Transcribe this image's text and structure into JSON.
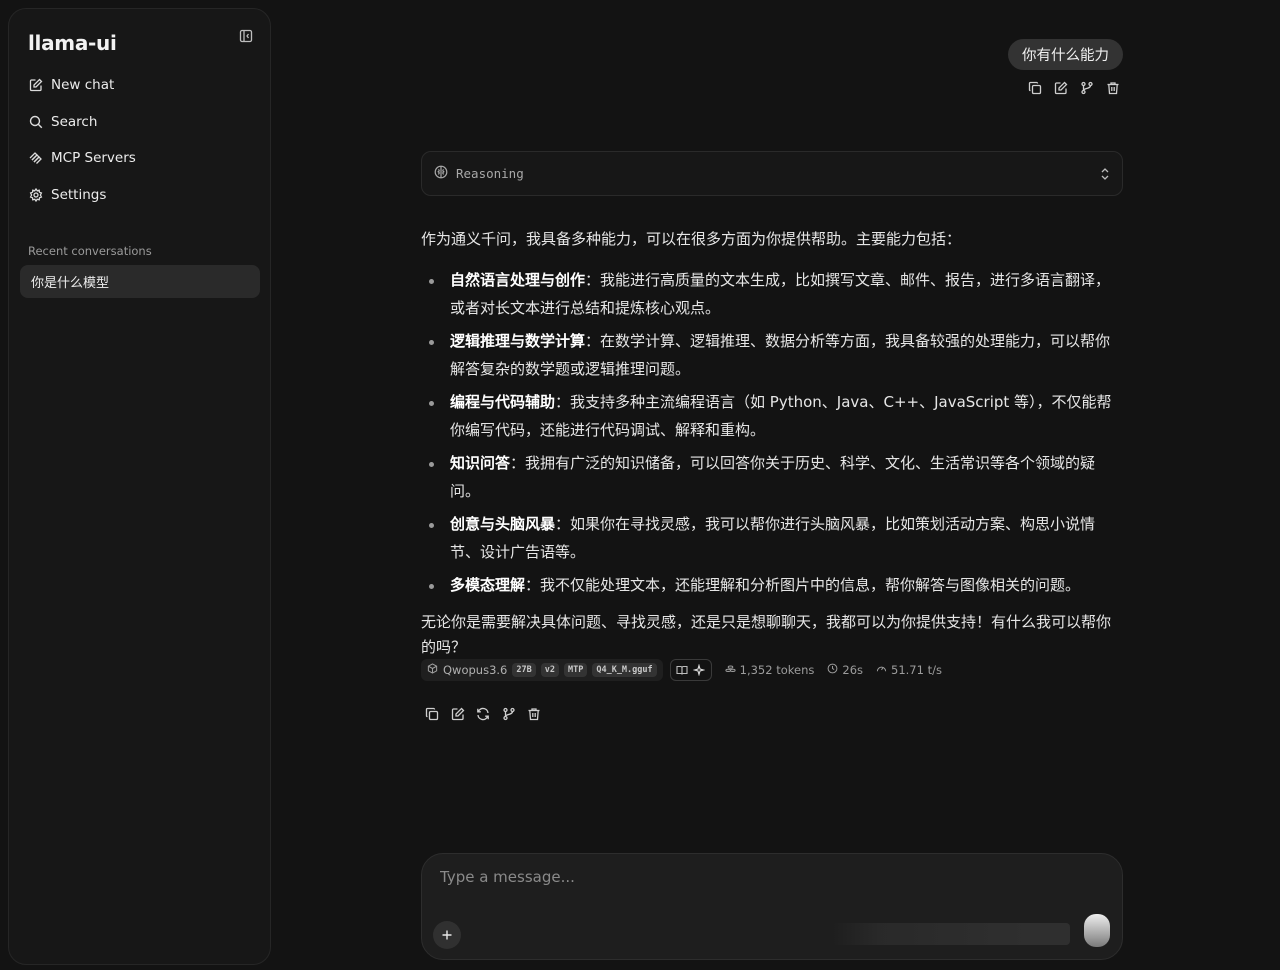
{
  "sidebar": {
    "brand": "llama-ui",
    "nav": [
      {
        "label": "New chat",
        "icon": "edit-icon"
      },
      {
        "label": "Search",
        "icon": "search-icon"
      },
      {
        "label": "MCP Servers",
        "icon": "mcp-icon"
      },
      {
        "label": "Settings",
        "icon": "gear-icon"
      }
    ],
    "recent_label": "Recent conversations",
    "conversations": [
      {
        "title": "你是什么模型",
        "active": true
      }
    ]
  },
  "chat": {
    "user_message": "你有什么能力",
    "reasoning_label": "Reasoning",
    "answer": {
      "intro": "作为通义千问，我具备多种能力，可以在很多方面为你提供帮助。主要能力包括：",
      "items": [
        {
          "title": "自然语言处理与创作",
          "text": "：我能进行高质量的文本生成，比如撰写文章、邮件、报告，进行多语言翻译，或者对长文本进行总结和提炼核心观点。"
        },
        {
          "title": "逻辑推理与数学计算",
          "text": "：在数学计算、逻辑推理、数据分析等方面，我具备较强的处理能力，可以帮你解答复杂的数学题或逻辑推理问题。"
        },
        {
          "title": "编程与代码辅助",
          "text": "：我支持多种主流编程语言（如 Python、Java、C++、JavaScript 等），不仅能帮你编写代码，还能进行代码调试、解释和重构。"
        },
        {
          "title": "知识问答",
          "text": "：我拥有广泛的知识储备，可以回答你关于历史、科学、文化、生活常识等各个领域的疑问。"
        },
        {
          "title": "创意与头脑风暴",
          "text": "：如果你在寻找灵感，我可以帮你进行头脑风暴，比如策划活动方案、构思小说情节、设计广告语等。"
        },
        {
          "title": "多模态理解",
          "text": "：我不仅能处理文本，还能理解和分析图片中的信息，帮你解答与图像相关的问题。"
        }
      ],
      "outro": "无论你是需要解决具体问题、寻找灵感，还是只是想聊聊天，我都可以为你提供支持！有什么我可以帮你的吗？"
    },
    "meta": {
      "model": "Qwopus3.6",
      "tags": [
        "27B",
        "v2",
        "MTP",
        "Q4_K_M.gguf"
      ],
      "tokens": "1,352 tokens",
      "time": "26s",
      "speed": "51.71 t/s"
    }
  },
  "composer": {
    "placeholder": "Type a message..."
  }
}
